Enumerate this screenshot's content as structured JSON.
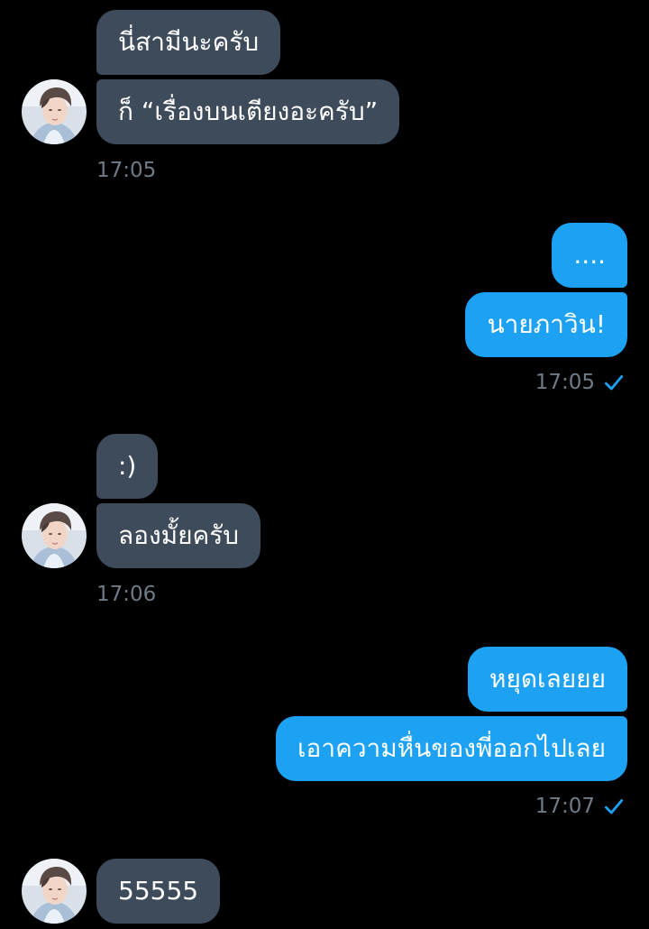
{
  "conversation": {
    "groups": [
      {
        "side": "incoming",
        "messages": [
          "นี่สามีนะครับ",
          "ก็ “เรื่องบนเตียงอะครับ”"
        ],
        "time": "17:05"
      },
      {
        "side": "outgoing",
        "messages": [
          "....",
          "นายภาวิน!"
        ],
        "time": "17:05",
        "status_icon": "check-icon"
      },
      {
        "side": "incoming",
        "messages": [
          ":)",
          "ลองมั้ยครับ"
        ],
        "time": "17:06"
      },
      {
        "side": "outgoing",
        "messages": [
          "หยุดเลยยย",
          "เอาความหื่นของพี่ออกไปเลย"
        ],
        "time": "17:07",
        "status_icon": "check-icon"
      },
      {
        "side": "incoming",
        "messages": [
          "55555"
        ]
      }
    ]
  },
  "colors": {
    "background": "#000000",
    "incoming_bubble": "#3d4b5b",
    "outgoing_bubble": "#1da1f2",
    "timestamp": "#6f7b87",
    "read_check": "#1da1f2"
  }
}
